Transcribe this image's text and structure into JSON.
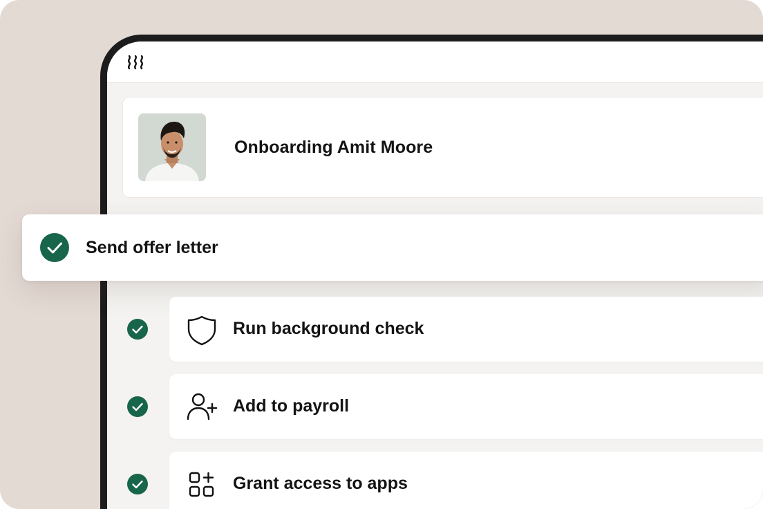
{
  "colors": {
    "background": "#e4dad4",
    "check_green": "#17654a",
    "device_frame": "#1c1c1c",
    "screen": "#f4f3f1"
  },
  "app": {
    "logo_icon": "brand-logo-icon"
  },
  "profile": {
    "title": "Onboarding Amit Moore",
    "avatar_icon": "avatar"
  },
  "tasks": [
    {
      "label": "Send offer letter",
      "done": true,
      "icon": "check-icon"
    },
    {
      "label": "Run background check",
      "done": true,
      "icon": "shield-icon"
    },
    {
      "label": "Add to payroll",
      "done": true,
      "icon": "add-user-icon"
    },
    {
      "label": "Grant access to apps",
      "done": true,
      "icon": "apps-grid-icon"
    }
  ]
}
